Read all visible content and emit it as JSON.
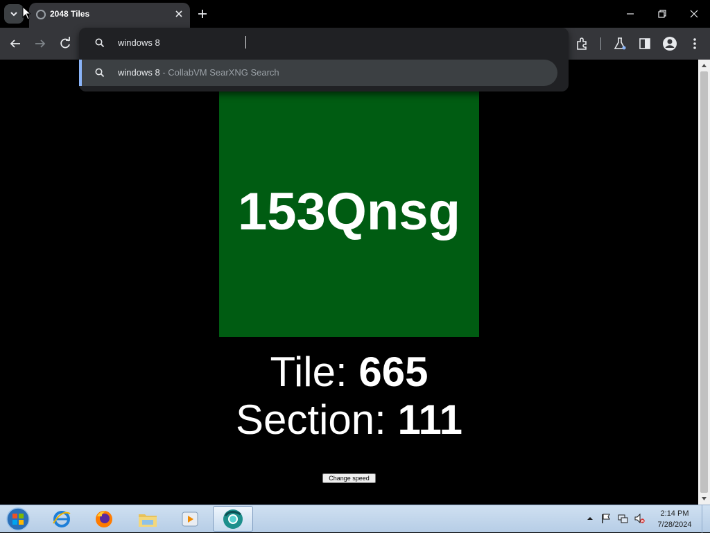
{
  "browser": {
    "tab": {
      "title": "2048 Tiles"
    },
    "omnibox": {
      "input_value": "windows 8",
      "suggestion": {
        "query": "windows 8",
        "source": " - CollabVM SearXNG Search"
      }
    }
  },
  "page": {
    "tile_text": "153Qnsg",
    "tile_color": "#005c12",
    "tile_label": "Tile: ",
    "tile_value": "665",
    "section_label": "Section: ",
    "section_value": "111",
    "change_speed_button": "Change speed"
  },
  "taskbar": {
    "pinned": [
      "internet-explorer-icon",
      "firefox-icon",
      "file-explorer-icon",
      "media-player-icon",
      "chromium-icon"
    ],
    "active": "chromium-icon",
    "clock": {
      "time": "2:14 PM",
      "date": "7/28/2024"
    }
  },
  "colors": {
    "accent": "#8ab4f8",
    "toolbar": "#35363a",
    "omnibox_bg": "#202124",
    "suggestion_bg": "#3c4043"
  }
}
